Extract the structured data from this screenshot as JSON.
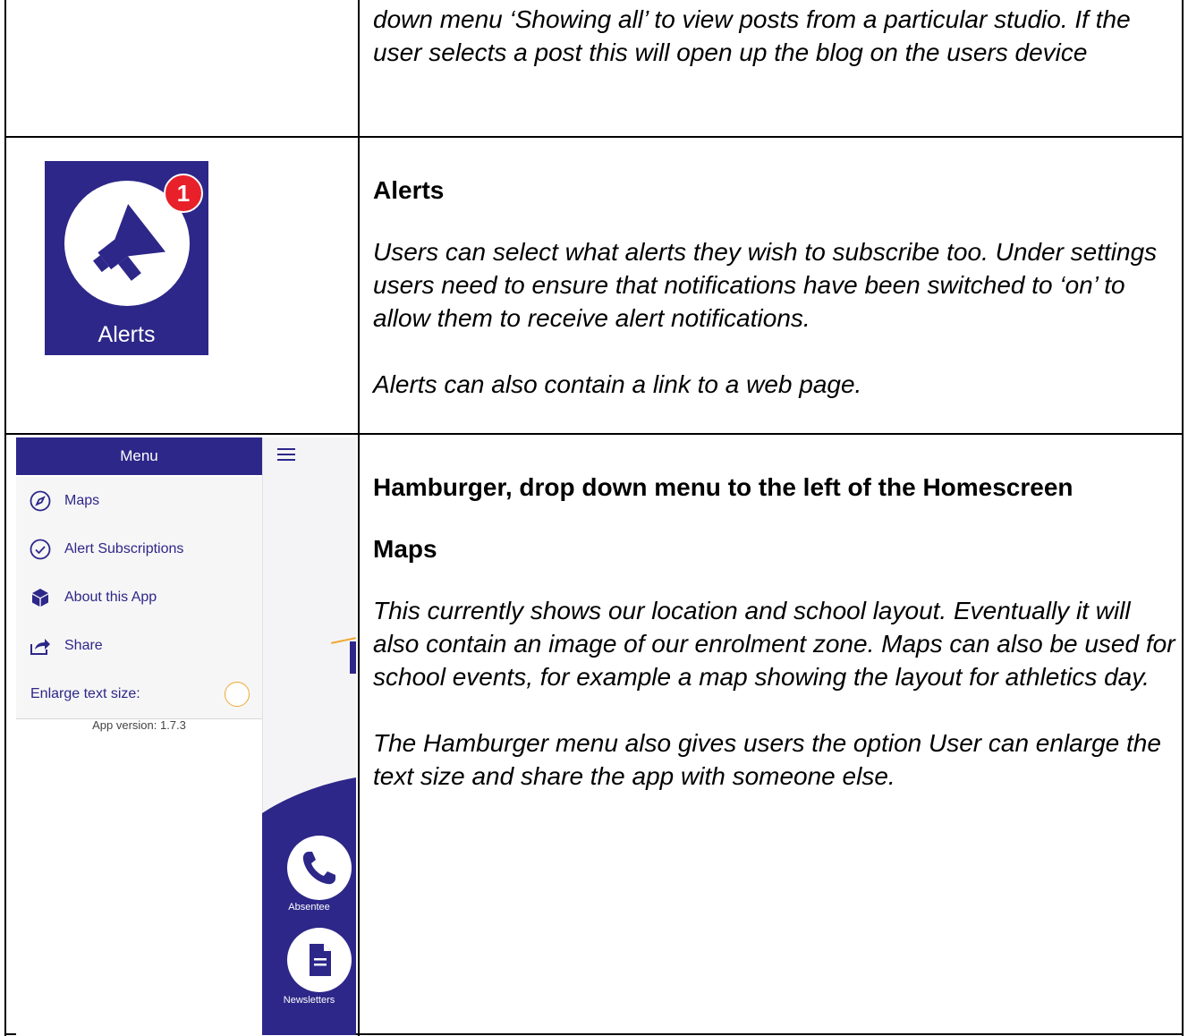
{
  "row1": {
    "text": "down menu ‘Showing all’ to view posts from a particular studio. If the user selects a post this will open up the blog on the users device"
  },
  "row2": {
    "icon": {
      "label": "Alerts",
      "badge": "1",
      "icon_name": "megaphone-icon",
      "bg_color": "#2d2789",
      "badge_color": "#e8202a"
    },
    "heading": "Alerts",
    "para1": "Users can select what alerts they wish to subscribe too.  Under settings users need to ensure that notifications have been switched to ‘on’ to allow them to receive alert notifications.",
    "para2": "Alerts can also contain a link to a web page."
  },
  "row3": {
    "screenshot": {
      "menu_title": "Menu",
      "items": [
        {
          "label": "Maps",
          "icon": "compass-icon"
        },
        {
          "label": "Alert Subscriptions",
          "icon": "check-circle-icon"
        },
        {
          "label": "About this App",
          "icon": "cube-icon"
        },
        {
          "label": "Share",
          "icon": "share-icon"
        }
      ],
      "enlarge_label": "Enlarge text size:",
      "app_version": "App version: 1.7.3",
      "home_buttons": [
        {
          "label": "Absentee",
          "icon": "phone-icon"
        },
        {
          "label": "Newsletters",
          "icon": "document-icon"
        }
      ]
    },
    "heading": "Hamburger, drop down menu to the left of the Homescreen",
    "subheading": "Maps",
    "para1": "This currently shows our location and school layout. Eventually it will also contain an image of our enrolment zone. Maps can also be used for school events, for example a map showing the layout for athletics day.",
    "para2": "The Hamburger menu also gives users the option User can enlarge the text size and share the app with someone else."
  },
  "colors": {
    "brand": "#2d2789",
    "accent": "#f0a832"
  }
}
